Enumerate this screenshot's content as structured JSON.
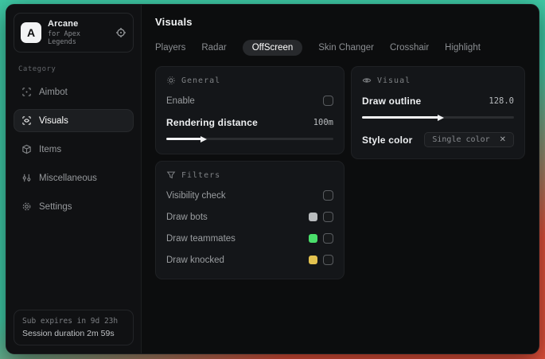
{
  "colors": {
    "bg-teal": "#3fcaa6",
    "bg-red": "#e2503a"
  },
  "sidebar": {
    "logo_letter": "A",
    "app_name": "Arcane",
    "app_subtitle": "for Apex Legends",
    "category_label": "Category",
    "items": [
      {
        "label": "Aimbot"
      },
      {
        "label": "Visuals"
      },
      {
        "label": "Items"
      },
      {
        "label": "Miscellaneous"
      },
      {
        "label": "Settings"
      }
    ],
    "footer": {
      "sub_expires": "Sub expires in 9d 23h",
      "session_duration": "Session duration 2m 59s"
    }
  },
  "main": {
    "title": "Visuals",
    "tabs": [
      {
        "label": "Players"
      },
      {
        "label": "Radar"
      },
      {
        "label": "OffScreen"
      },
      {
        "label": "Skin Changer"
      },
      {
        "label": "Crosshair"
      },
      {
        "label": "Highlight"
      }
    ],
    "general": {
      "title": "General",
      "enable_label": "Enable",
      "rendering_distance_label": "Rendering distance",
      "rendering_distance_value": "100m",
      "rendering_distance_percent": 21
    },
    "visual": {
      "title": "Visual",
      "draw_outline_label": "Draw outline",
      "draw_outline_value": "128.0",
      "draw_outline_percent": 50,
      "style_color_label": "Style color",
      "style_color_value": "Single color",
      "style_color_clear": "✕"
    },
    "filters": {
      "title": "Filters",
      "rows": [
        {
          "label": "Visibility check",
          "swatch": ""
        },
        {
          "label": "Draw bots",
          "swatch": "#b9bcbe"
        },
        {
          "label": "Draw teammates",
          "swatch": "#4ade6b"
        },
        {
          "label": "Draw knocked",
          "swatch": "#e3c24f"
        }
      ]
    }
  }
}
